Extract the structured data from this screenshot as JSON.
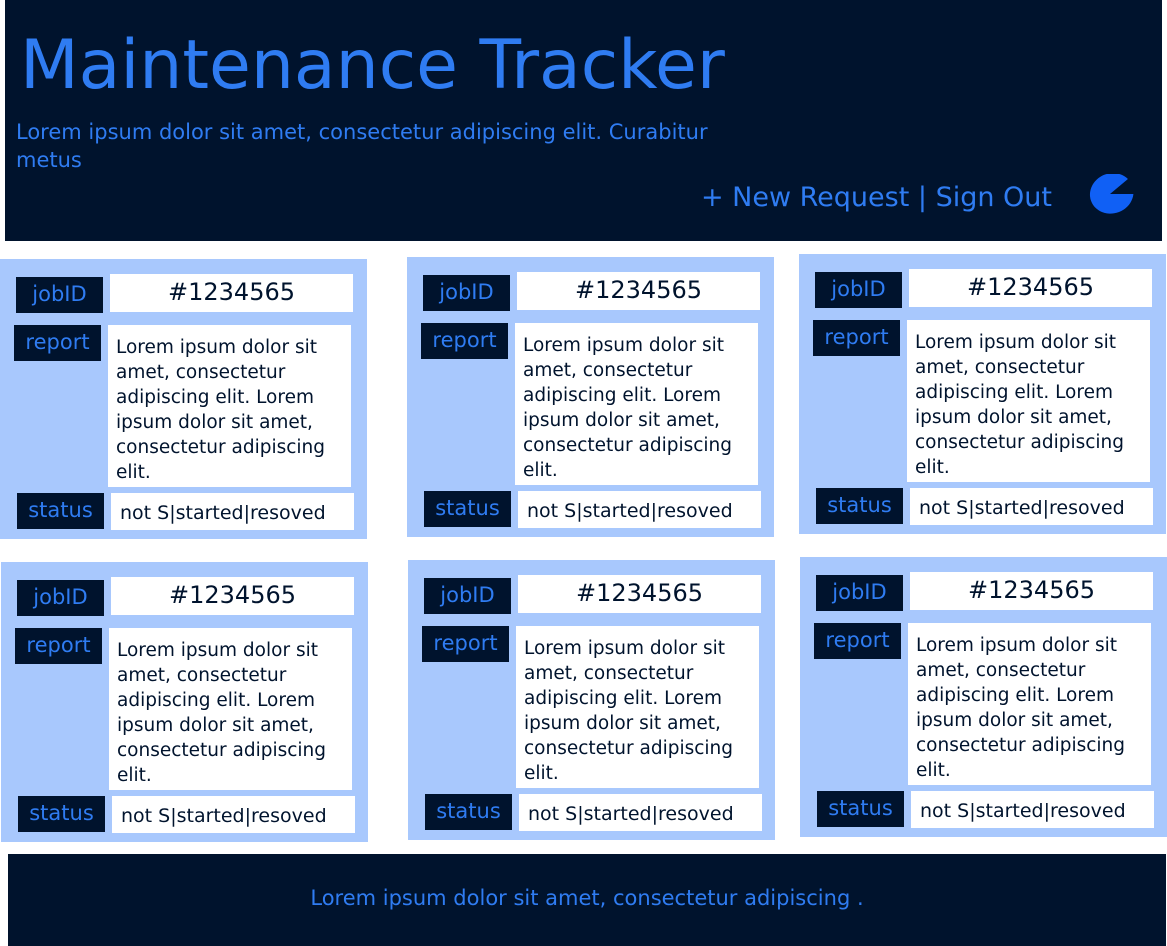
{
  "header": {
    "title": "Maintenance Tracker",
    "subtitle": "Lorem ipsum dolor sit amet, consectetur adipiscing elit. Curabitur metus",
    "new_request_label": "+ New Request",
    "separator": " | ",
    "sign_out_label": "Sign Out",
    "avatar_icon": "pacman-icon"
  },
  "labels": {
    "job_id": "jobID",
    "report": "report",
    "status": "status"
  },
  "cards": [
    {
      "job_id": "#1234565",
      "report": "Lorem ipsum dolor sit amet, consectetur adipiscing elit. Lorem ipsum dolor sit amet, consectetur adipiscing elit.",
      "status": "not S|started|resoved"
    },
    {
      "job_id": "#1234565",
      "report": "Lorem ipsum dolor sit amet, consectetur adipiscing elit. Lorem ipsum dolor sit amet, consectetur adipiscing elit.",
      "status": "not S|started|resoved"
    },
    {
      "job_id": "#1234565",
      "report": "Lorem ipsum dolor sit amet, consectetur adipiscing elit. Lorem ipsum dolor sit amet, consectetur adipiscing elit.",
      "status": "not S|started|resoved"
    },
    {
      "job_id": "#1234565",
      "report": "Lorem ipsum dolor sit amet, consectetur adipiscing elit. Lorem ipsum dolor sit amet, consectetur adipiscing elit.",
      "status": "not S|started|resoved"
    },
    {
      "job_id": "#1234565",
      "report": "Lorem ipsum dolor sit amet, consectetur adipiscing elit. Lorem ipsum dolor sit amet, consectetur adipiscing elit.",
      "status": "not S|started|resoved"
    },
    {
      "job_id": "#1234565",
      "report": "Lorem ipsum dolor sit amet, consectetur adipiscing elit. Lorem ipsum dolor sit amet, consectetur adipiscing elit.",
      "status": "not S|started|resoved"
    }
  ],
  "footer": {
    "text": "Lorem ipsum dolor sit amet, consectetur adipiscing ."
  },
  "colors": {
    "navy": "#00132d",
    "accent_blue": "#2f7cf2",
    "card_bg": "#a8c8fd",
    "avatar_blue": "#1060f5"
  }
}
